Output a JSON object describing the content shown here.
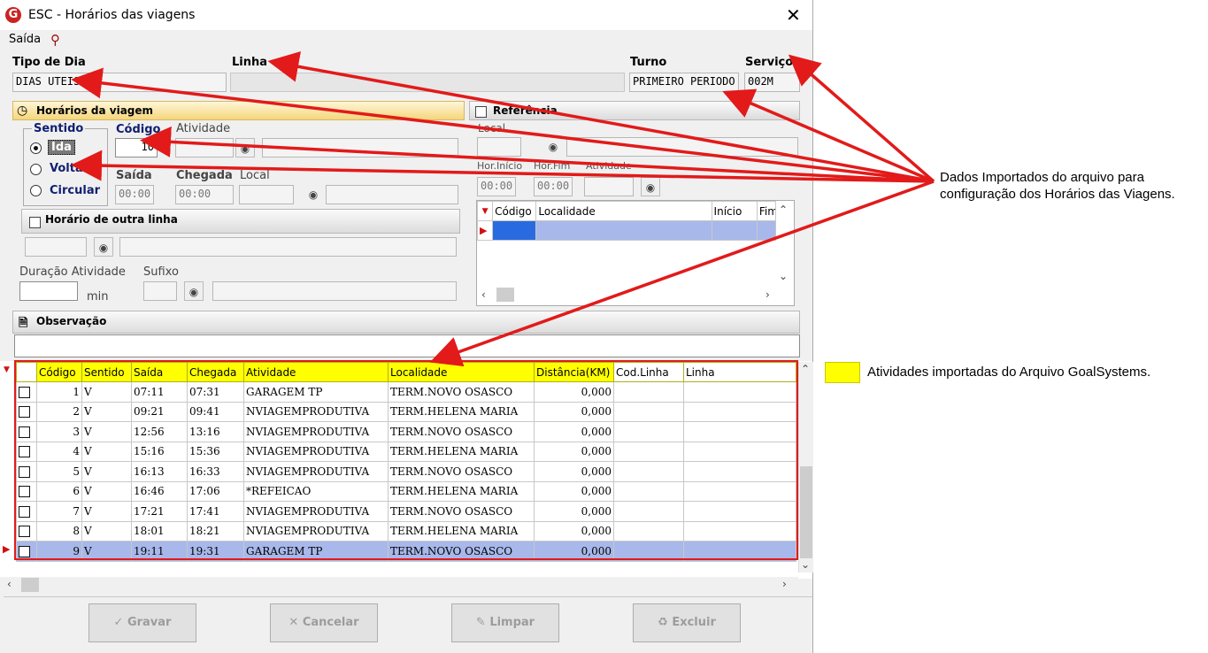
{
  "window": {
    "title": "ESC - Horários das viagens",
    "close_glyph": "✕",
    "app_icon_letter": "G"
  },
  "menu": {
    "saida": "Saída"
  },
  "labels": {
    "tipo_dia": "Tipo de Dia",
    "linha": "Linha",
    "turno": "Turno",
    "servico": "Serviço",
    "horarios_panel": "Horários da viagem",
    "sentido": "Sentido",
    "ida": "Ida",
    "volta": "Volta",
    "circular": "Circular",
    "codigo": "Código",
    "atividade": "Atividade",
    "saida": "Saída",
    "chegada": "Chegada",
    "local": "Local",
    "horario_outra_linha": "Horário de outra linha",
    "duracao_atividade": "Duração Atividade",
    "min": "min",
    "sufixo": "Sufixo",
    "observacao": "Observação",
    "referencia": "Referência",
    "ref_local": "Local",
    "hor_inicio": "Hor.Início",
    "hor_fim": "Hor.Fim",
    "ref_atividade": "Atividade"
  },
  "fields": {
    "tipo_dia": "DIAS UTEIS",
    "turno": "PRIMEIRO PERIODO",
    "servico": "002M",
    "codigo": "10",
    "saida": "00:00",
    "chegada": "00:00",
    "ref_hor_inicio": "00:00",
    "ref_hor_fim": "00:00"
  },
  "ref_grid": {
    "columns": [
      "Código",
      "Localidade",
      "Início",
      "Fim"
    ]
  },
  "main_grid": {
    "columns": [
      "Código",
      "Sentido",
      "Saída",
      "Chegada",
      "Atividade",
      "Localidade",
      "Distância(KM)",
      "Cod.Linha",
      "Linha"
    ],
    "rows": [
      {
        "codigo": "1",
        "sentido": "V",
        "saida": "07:11",
        "chegada": "07:31",
        "atividade": "GARAGEM TP",
        "localidade": "TERM.NOVO OSASCO",
        "distancia": "0,000"
      },
      {
        "codigo": "2",
        "sentido": "V",
        "saida": "09:21",
        "chegada": "09:41",
        "atividade": "NVIAGEMPRODUTIVA",
        "localidade": "TERM.HELENA MARIA",
        "distancia": "0,000"
      },
      {
        "codigo": "3",
        "sentido": "V",
        "saida": "12:56",
        "chegada": "13:16",
        "atividade": "NVIAGEMPRODUTIVA",
        "localidade": "TERM.NOVO OSASCO",
        "distancia": "0,000"
      },
      {
        "codigo": "4",
        "sentido": "V",
        "saida": "15:16",
        "chegada": "15:36",
        "atividade": "NVIAGEMPRODUTIVA",
        "localidade": "TERM.HELENA MARIA",
        "distancia": "0,000"
      },
      {
        "codigo": "5",
        "sentido": "V",
        "saida": "16:13",
        "chegada": "16:33",
        "atividade": "NVIAGEMPRODUTIVA",
        "localidade": "TERM.NOVO OSASCO",
        "distancia": "0,000"
      },
      {
        "codigo": "6",
        "sentido": "V",
        "saida": "16:46",
        "chegada": "17:06",
        "atividade": "*REFEICAO",
        "localidade": "TERM.HELENA MARIA",
        "distancia": "0,000"
      },
      {
        "codigo": "7",
        "sentido": "V",
        "saida": "17:21",
        "chegada": "17:41",
        "atividade": "NVIAGEMPRODUTIVA",
        "localidade": "TERM.NOVO OSASCO",
        "distancia": "0,000"
      },
      {
        "codigo": "8",
        "sentido": "V",
        "saida": "18:01",
        "chegada": "18:21",
        "atividade": "NVIAGEMPRODUTIVA",
        "localidade": "TERM.HELENA MARIA",
        "distancia": "0,000"
      },
      {
        "codigo": "9",
        "sentido": "V",
        "saida": "19:11",
        "chegada": "19:31",
        "atividade": "GARAGEM TP",
        "localidade": "TERM.NOVO OSASCO",
        "distancia": "0,000"
      }
    ]
  },
  "buttons": {
    "gravar": "Gravar",
    "cancelar": "Cancelar",
    "limpar": "Limpar",
    "excluir": "Excluir"
  },
  "annotations": {
    "dados_importados": "Dados Importados do arquivo para configuração dos Horários das Viagens.",
    "atividades_importadas": "Atividades importadas do Arquivo GoalSystems."
  },
  "colors": {
    "highlight_yellow": "#ffff00",
    "arrow_red": "#e21a1a",
    "panel_header": "#f4d67c",
    "selected_row": "#a8b8ea"
  }
}
